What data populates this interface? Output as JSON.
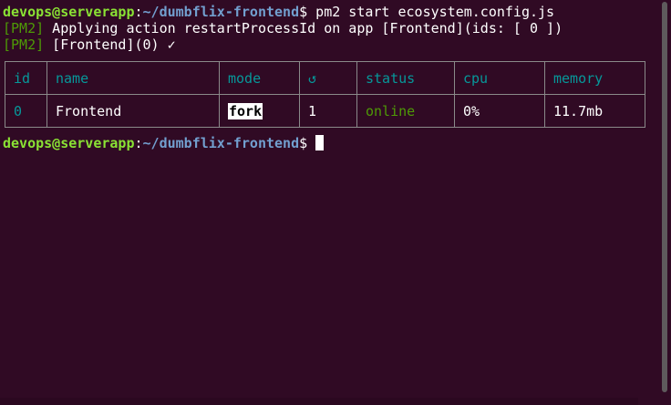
{
  "prompt": {
    "user_host": "devops@serverapp",
    "separator": ":",
    "path": "~/dumbflix-frontend",
    "symbol": "$"
  },
  "command": " pm2 start ecosystem.config.js",
  "output": {
    "line1": {
      "tag": "[PM2]",
      "text": " Applying action restartProcessId on app [Frontend](ids: [ 0 ])"
    },
    "line2": {
      "tag": "[PM2]",
      "text": " [Frontend](0) ✓"
    }
  },
  "table": {
    "headers": {
      "id": "id",
      "name": "name",
      "mode": "mode",
      "restarts": "↺",
      "status": "status",
      "cpu": "cpu",
      "memory": "memory"
    },
    "rows": [
      {
        "id": "0",
        "name": "Frontend",
        "mode": "fork",
        "restarts": "1",
        "status": "online",
        "cpu": "0%",
        "memory": "11.7mb"
      }
    ]
  },
  "colors": {
    "background": "#300a24",
    "prompt_user": "#8ae234",
    "prompt_path": "#729fcf",
    "table_header": "#06989a",
    "status_online": "#4e9a06",
    "pm2_tag": "#4e9a06"
  }
}
